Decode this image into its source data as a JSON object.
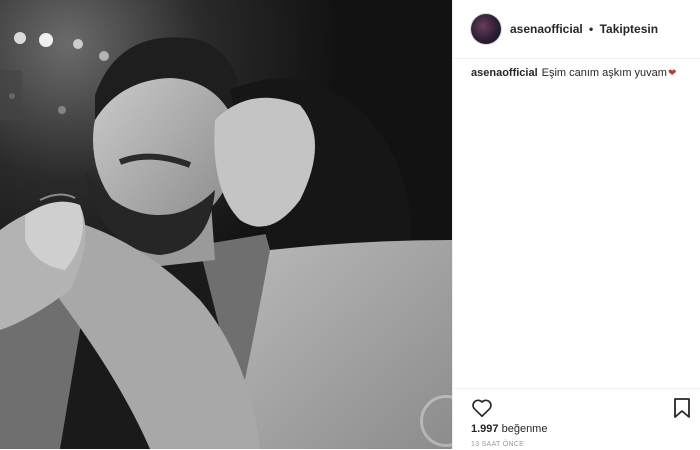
{
  "post": {
    "username": "asenaofficial",
    "separator": "•",
    "follow_status": "Takiptesin",
    "caption": {
      "username": "asenaofficial",
      "text": "Eşim canım aşkım yuvam"
    },
    "likes_count": "1.997",
    "likes_label": "beğenme",
    "timestamp": "13 SAAT ÖNCE",
    "icons": {
      "like": "heart-outline-icon",
      "save": "bookmark-outline-icon",
      "caption_emoji": "red-heart-icon"
    },
    "colors": {
      "text": "#262626",
      "border": "#efefef",
      "muted": "#999999",
      "emoji_heart": "#c0392b"
    }
  }
}
